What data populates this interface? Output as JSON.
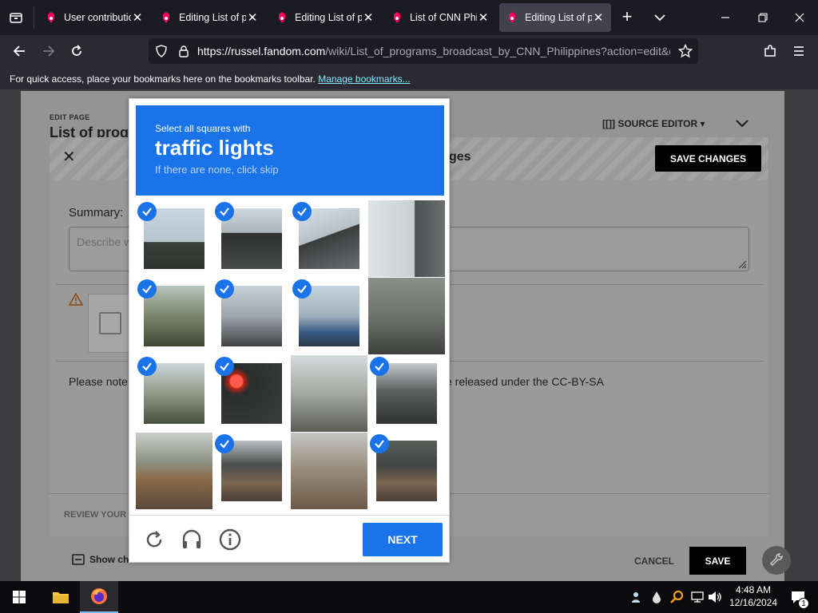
{
  "tabs": [
    {
      "title": "User contributio",
      "active": false
    },
    {
      "title": "Editing List of pr",
      "active": false
    },
    {
      "title": "Editing List of pr",
      "active": false
    },
    {
      "title": "List of CNN Phil",
      "active": false
    },
    {
      "title": "Editing List of pr",
      "active": true
    }
  ],
  "url": {
    "main": "https://russel.fandom.com",
    "rest": "/wiki/List_of_programs_broadcast_by_CNN_Philippines?action=edit&ol"
  },
  "bookmarks": {
    "text": "For quick access, place your bookmarks here on the bookmarks toolbar.",
    "link": "Manage bookmarks..."
  },
  "page": {
    "edit_label": "EDIT PAGE",
    "title": "List of prog",
    "source_editor": "[[]] SOURCE EDITOR ▾",
    "dialog_header": "ges",
    "save_changes": "SAVE CHANGES",
    "summary_label": "Summary:",
    "summary_placeholder": "Describe w",
    "please_note": "Please note",
    "released": "e released under the CC-BY-SA",
    "review": "REVIEW YOUR",
    "show_changes": "Show ch",
    "cancel": "CANCEL",
    "save": "SAVE"
  },
  "captcha": {
    "instruction": "Select all squares with",
    "target": "traffic lights",
    "hint": "If there are none, click skip",
    "next": "NEXT",
    "selected_tiles": [
      0,
      1,
      2,
      4,
      5,
      6,
      8,
      9,
      11,
      13,
      15
    ]
  },
  "taskbar": {
    "time": "4:48 AM",
    "date": "12/16/2024",
    "notif_count": "1"
  },
  "colors": {
    "accent": "#1a73e8",
    "chrome_dark": "#1c1b22",
    "toolbar": "#2b2a33",
    "link": "#80ebff"
  }
}
